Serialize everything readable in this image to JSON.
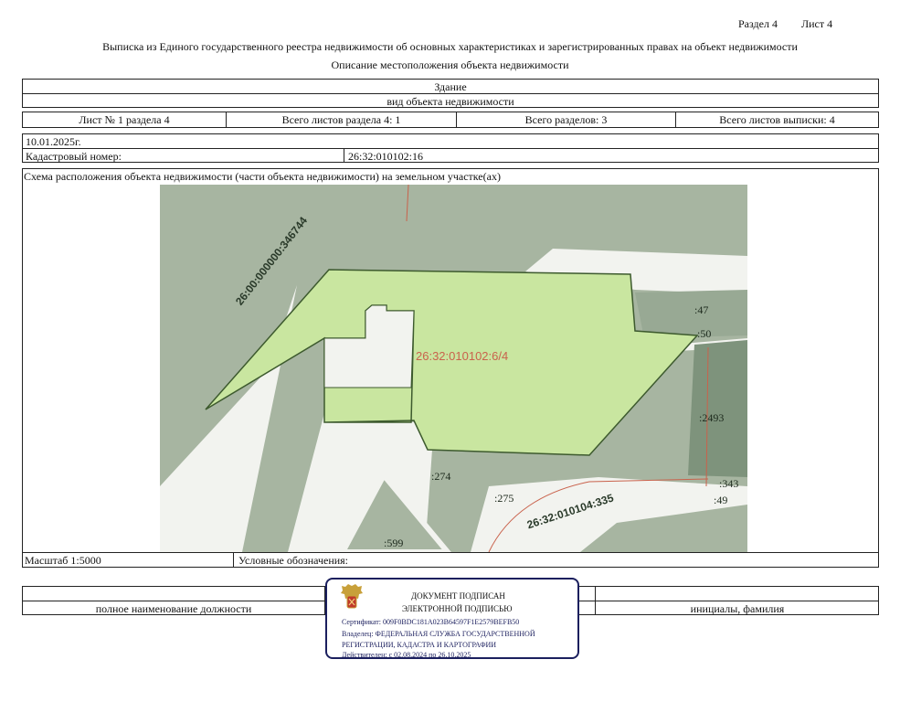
{
  "header": {
    "section": "Раздел 4",
    "sheet": "Лист 4",
    "title": "Выписка из Единого государственного реестра недвижимости об основных характеристиках и зарегистрированных правах на объект недвижимости",
    "subtitle": "Описание местоположения объекта недвижимости"
  },
  "object": {
    "type": "Здание",
    "type_caption": "вид объекта недвижимости"
  },
  "sheet_info": {
    "sheet_of_section": "Лист № 1 раздела 4",
    "total_sheets_section": "Всего листов раздела 4: 1",
    "total_sections": "Всего разделов: 3",
    "total_sheets": "Всего листов выписки: 4"
  },
  "date": "10.01.2025г.",
  "cadastral": {
    "label": "Кадастровый номер:",
    "value": "26:32:010102:16"
  },
  "scheme": {
    "caption": "Схема расположения объекта недвижимости (части объекта недвижимости) на земельном участке(ах)"
  },
  "map": {
    "colors": {
      "background": "#a7b5a1",
      "parcel": "#c9e6a0",
      "road": "#f2f3ef",
      "dark": "#7e937c",
      "red_line": "#c9624c"
    },
    "labels": {
      "main_parcel": "26:32:010102:6/4",
      "boundary_nw": "26:00:000000:346744",
      "boundary_se": "26:32:010104:335",
      "l47": ":47",
      "l50": ":50",
      "l2493": ":2493",
      "l274": ":274",
      "l275": ":275",
      "l343": ":343",
      "l49": ":49",
      "l599": ":599"
    }
  },
  "footer_row": {
    "scale": "Масштаб 1:5000",
    "legend": "Условные обозначения:"
  },
  "signature_row": {
    "position": "полное наименование должности",
    "initials": "инициалы, фамилия"
  },
  "stamp": {
    "title1": "ДОКУМЕНТ ПОДПИСАН",
    "title2": "ЭЛЕКТРОННОЙ ПОДПИСЬЮ",
    "certificate": "Сертификат: 009F0BDC181A023B64597F1E2579BEFB50",
    "owner1": "Владелец: ФЕДЕРАЛЬНАЯ СЛУЖБА ГОСУДАРСТВЕННОЙ",
    "owner2": "РЕГИСТРАЦИИ, КАДАСТРА И КАРТОГРАФИИ",
    "valid": "Действителен: с 02.08.2024 по 26.10.2025",
    "emblem_icon": "double-headed-eagle-icon"
  }
}
